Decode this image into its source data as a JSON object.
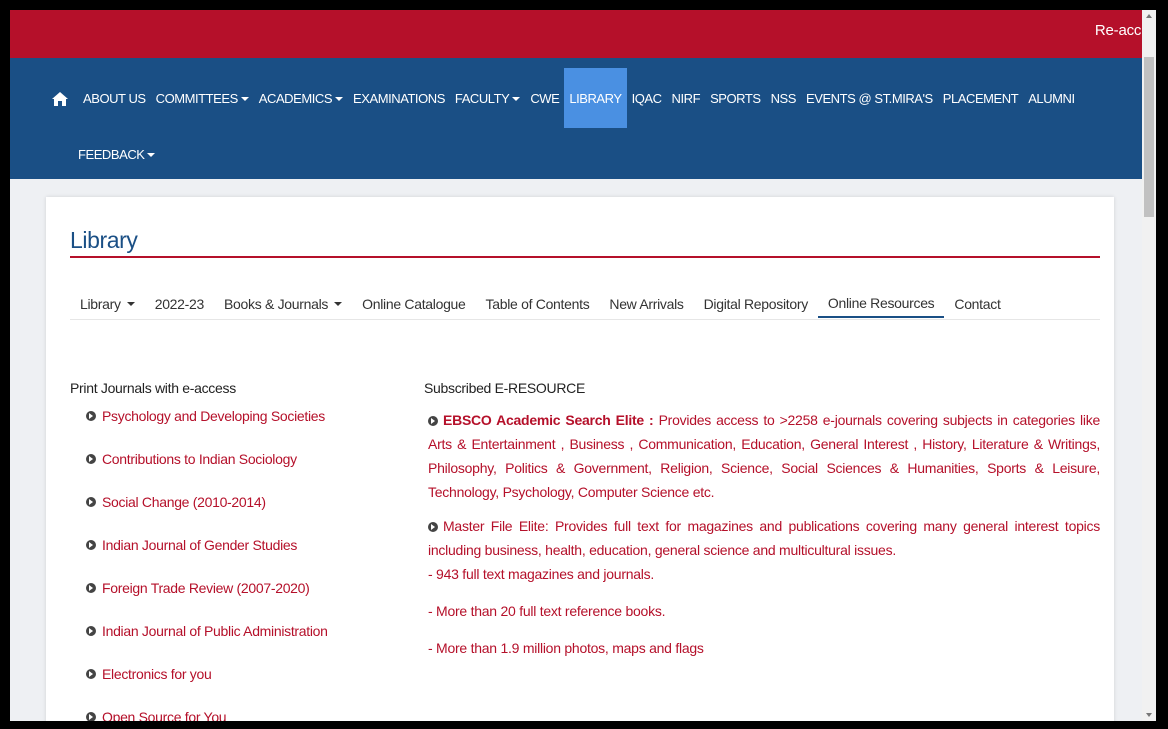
{
  "topbar": {
    "text": "Re-accr"
  },
  "nav": {
    "home_icon": "home-icon",
    "row1": [
      {
        "label": "ABOUT US",
        "caret": false
      },
      {
        "label": "COMMITTEES",
        "caret": true
      },
      {
        "label": "ACADEMICS",
        "caret": true
      },
      {
        "label": "EXAMINATIONS",
        "caret": false
      },
      {
        "label": "FACULTY",
        "caret": true
      },
      {
        "label": "CWE",
        "caret": false
      },
      {
        "label": "LIBRARY",
        "caret": false,
        "active": true
      },
      {
        "label": "IQAC",
        "caret": false
      },
      {
        "label": "NIRF",
        "caret": false
      },
      {
        "label": "SPORTS",
        "caret": false
      },
      {
        "label": "NSS",
        "caret": false
      },
      {
        "label": "EVENTS @ ST.MIRA'S",
        "caret": false
      },
      {
        "label": "PLACEMENT",
        "caret": false
      },
      {
        "label": "ALUMNI",
        "caret": false
      }
    ],
    "row2": [
      {
        "label": "FEEDBACK",
        "caret": true
      }
    ]
  },
  "card": {
    "title": "Library",
    "subnav": [
      {
        "label": "Library",
        "caret": true
      },
      {
        "label": "2022-23",
        "caret": false
      },
      {
        "label": "Books & Journals",
        "caret": true
      },
      {
        "label": "Online Catalogue",
        "caret": false
      },
      {
        "label": "Table of Contents",
        "caret": false
      },
      {
        "label": "New Arrivals",
        "caret": false
      },
      {
        "label": "Digital Repository",
        "caret": false
      },
      {
        "label": "Online Resources",
        "caret": false,
        "active": true
      },
      {
        "label": "Contact",
        "caret": false
      }
    ],
    "left": {
      "heading": "Print Journals with e-access",
      "items": [
        "Psychology and Developing Societies",
        "Contributions to Indian Sociology",
        "Social Change (2010-2014)",
        "Indian Journal of Gender Studies",
        "Foreign Trade Review (2007-2020)",
        "Indian Journal of Public Administration",
        "Electronics for you",
        "Open Source for You"
      ]
    },
    "right": {
      "heading": "Subscribed E-RESOURCE",
      "ebsco_name": "EBSCO Academic Search Elite :",
      "ebsco_desc": " Provides access to >2258 e-journals covering subjects in categories like Arts & Entertainment , Business , Communication, Education, General Interest , History, Literature & Writings, Philosophy, Politics & Government, Religion, Science, Social Sciences & Humanities, Sports & Leisure, Technology, Psychology, Computer Science etc.",
      "master_desc": "Master File Elite: Provides full text for magazines and publications covering many general interest topics including business, health, education, general science and multicultural issues.",
      "lines": [
        "- 943 full text magazines and journals.",
        "- More than 20 full text reference books.",
        "- More than 1.9 million photos, maps and flags"
      ]
    }
  },
  "colors": {
    "brand_red": "#b5102a",
    "nav_blue": "#1a4f85",
    "active_blue": "#4a90e2"
  }
}
